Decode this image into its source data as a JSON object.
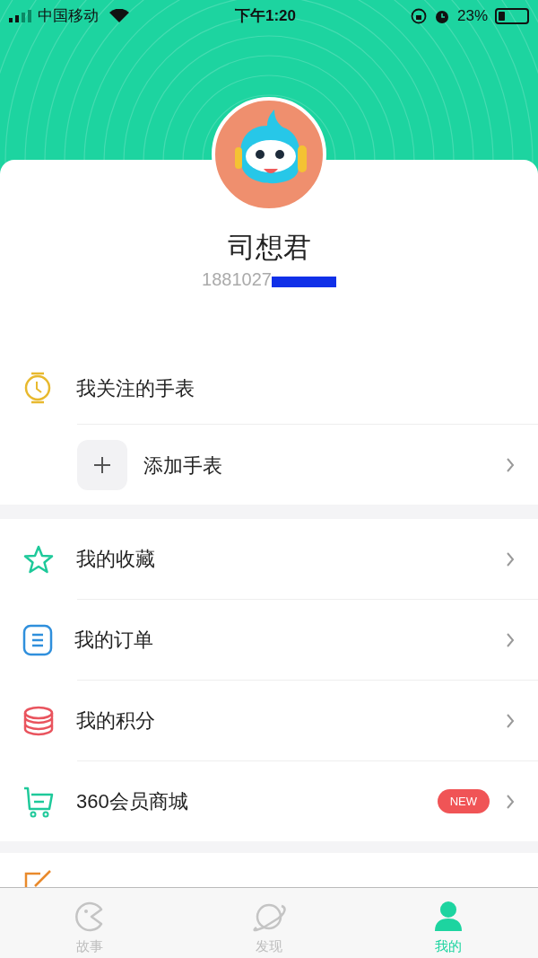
{
  "status_bar": {
    "carrier": "中国移动",
    "time": "下午1:20",
    "battery": "23%"
  },
  "profile": {
    "name": "司想君",
    "phone": "1881027"
  },
  "watch_section": {
    "title": "我关注的手表",
    "add_label": "添加手表"
  },
  "menu": [
    {
      "kind": "star",
      "label": "我的收藏"
    },
    {
      "kind": "order",
      "label": "我的订单"
    },
    {
      "kind": "points",
      "label": "我的积分"
    },
    {
      "kind": "cart",
      "label": "360会员商城",
      "badge": "NEW"
    }
  ],
  "partial_item": {
    "kind": "feedback"
  },
  "tabs": [
    {
      "kind": "story",
      "label": "故事",
      "selected": false
    },
    {
      "kind": "discover",
      "label": "发现",
      "selected": false
    },
    {
      "kind": "me",
      "label": "我的",
      "selected": true
    }
  ]
}
